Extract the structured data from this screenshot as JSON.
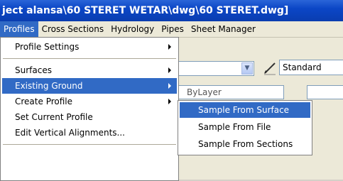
{
  "window": {
    "title": "ject alansa\\60 STERET WETAR\\dwg\\60 STERET.dwg]"
  },
  "menubar": {
    "items": [
      "Profiles",
      "Cross Sections",
      "Hydrology",
      "Pipes",
      "Sheet Manager"
    ],
    "active": "Profiles"
  },
  "profiles_menu": {
    "items": [
      {
        "label": "Profile Settings",
        "submenu": true
      },
      {
        "label": "Surfaces",
        "submenu": true
      },
      {
        "label": "Existing Ground",
        "submenu": true,
        "highlighted": true
      },
      {
        "label": "Create Profile",
        "submenu": true
      },
      {
        "label": "Set Current Profile",
        "submenu": false
      },
      {
        "label": "Edit Vertical Alignments...",
        "submenu": false
      }
    ]
  },
  "existing_ground_submenu": {
    "items": [
      {
        "label": "Sample From Surface",
        "highlighted": true
      },
      {
        "label": "Sample From File"
      },
      {
        "label": "Sample From Sections"
      }
    ]
  },
  "toolbar": {
    "style_combo_value": "Standard",
    "layer_combo_value": "ByLayer"
  },
  "colors": {
    "title_bar": "#0b46c6",
    "highlight": "#316ac5",
    "menu_bg": "#ece9d8"
  },
  "icons": [
    "dropdown-arrow-icon",
    "brush-icon",
    "submenu-arrow-icon"
  ]
}
